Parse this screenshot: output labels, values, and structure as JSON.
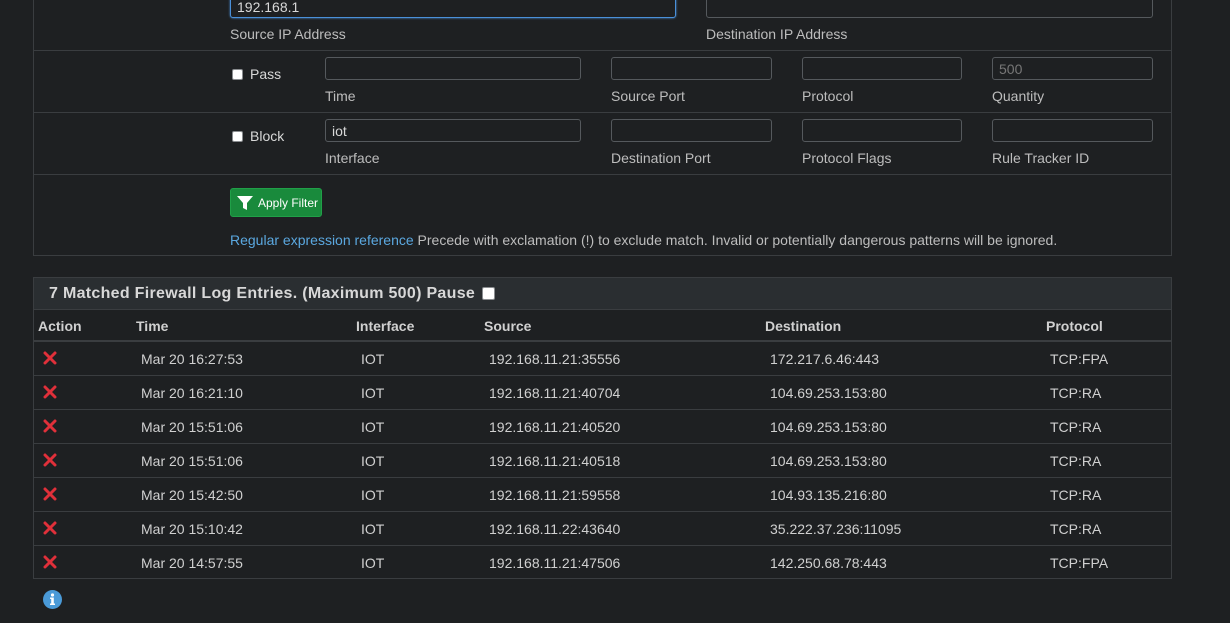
{
  "filter": {
    "source_ip": {
      "value": "192.168.1",
      "label": "Source IP Address"
    },
    "dest_ip": {
      "value": "",
      "label": "Destination IP Address"
    },
    "pass": {
      "label": "Pass"
    },
    "block": {
      "label": "Block"
    },
    "time": {
      "value": "",
      "label": "Time"
    },
    "source_port": {
      "value": "",
      "label": "Source Port"
    },
    "protocol": {
      "value": "",
      "label": "Protocol"
    },
    "quantity": {
      "value": "",
      "placeholder": "500",
      "label": "Quantity"
    },
    "interface": {
      "value": "iot",
      "label": "Interface"
    },
    "dest_port": {
      "value": "",
      "label": "Destination Port"
    },
    "protocol_flags": {
      "value": "",
      "label": "Protocol Flags"
    },
    "rule_tracker": {
      "value": "",
      "label": "Rule Tracker ID"
    },
    "apply_label": "Apply Filter",
    "regex_link": "Regular expression reference",
    "note": " Precede with exclamation (!) to exclude match. Invalid or potentially dangerous patterns will be ignored."
  },
  "log": {
    "title": "7 Matched Firewall Log Entries. (Maximum 500) Pause",
    "columns": [
      "Action",
      "Time",
      "Interface",
      "Source",
      "Destination",
      "Protocol"
    ],
    "rows": [
      {
        "time": "Mar 20 16:27:53",
        "interface": "IOT",
        "source": "192.168.11.21:35556",
        "destination": "172.217.6.46:443",
        "protocol": "TCP:FPA"
      },
      {
        "time": "Mar 20 16:21:10",
        "interface": "IOT",
        "source": "192.168.11.21:40704",
        "destination": "104.69.253.153:80",
        "protocol": "TCP:RA"
      },
      {
        "time": "Mar 20 15:51:06",
        "interface": "IOT",
        "source": "192.168.11.21:40520",
        "destination": "104.69.253.153:80",
        "protocol": "TCP:RA"
      },
      {
        "time": "Mar 20 15:51:06",
        "interface": "IOT",
        "source": "192.168.11.21:40518",
        "destination": "104.69.253.153:80",
        "protocol": "TCP:RA"
      },
      {
        "time": "Mar 20 15:42:50",
        "interface": "IOT",
        "source": "192.168.11.21:59558",
        "destination": "104.93.135.216:80",
        "protocol": "TCP:RA"
      },
      {
        "time": "Mar 20 15:10:42",
        "interface": "IOT",
        "source": "192.168.11.22:43640",
        "destination": "35.222.37.236:11095",
        "protocol": "TCP:RA"
      },
      {
        "time": "Mar 20 14:57:55",
        "interface": "IOT",
        "source": "192.168.11.21:47506",
        "destination": "142.250.68.78:443",
        "protocol": "TCP:FPA"
      }
    ]
  },
  "colors": {
    "block_action": "#e0303a",
    "apply_button": "#198a3c",
    "link": "#5ba8e0",
    "info": "#4a9ad8"
  },
  "icons": {
    "action": "x-icon",
    "apply": "filter-icon",
    "info": "info-icon"
  }
}
